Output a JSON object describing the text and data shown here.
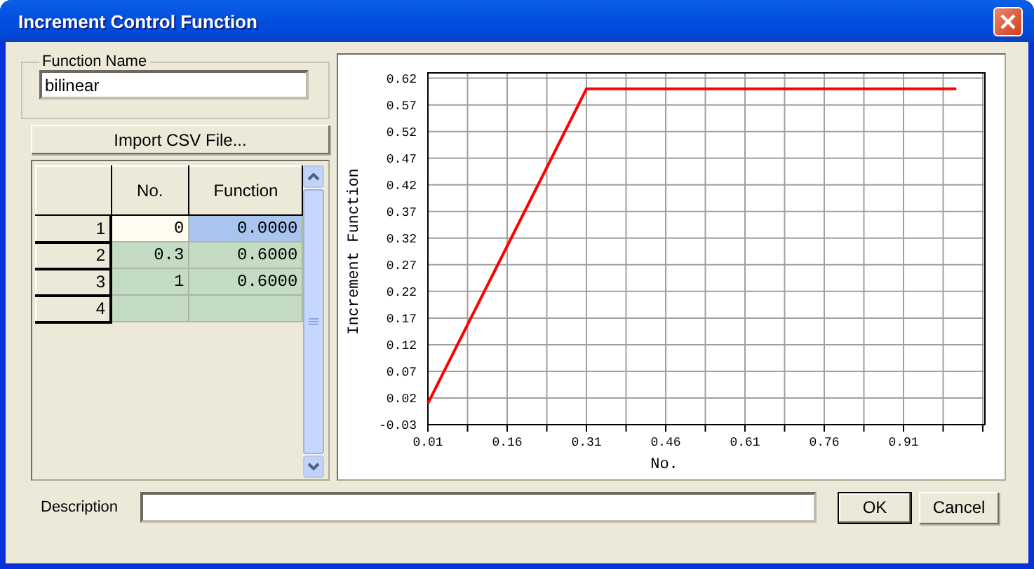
{
  "window": {
    "title": "Increment Control Function"
  },
  "function_name": {
    "label": "Function Name",
    "value": "bilinear"
  },
  "import_button": "Import CSV File...",
  "table": {
    "columns": [
      "No.",
      "Function"
    ],
    "rows": [
      {
        "header": "1",
        "no": "0",
        "function": "0.0000",
        "selected": true
      },
      {
        "header": "2",
        "no": "0.3",
        "function": "0.6000",
        "selected": false
      },
      {
        "header": "3",
        "no": "1",
        "function": "0.6000",
        "selected": false
      },
      {
        "header": "4",
        "selected": false
      }
    ]
  },
  "chart": {
    "chart_data": {
      "type": "line",
      "xlabel": "No.",
      "ylabel": "Increment Function",
      "xlim": [
        0.01,
        1.064
      ],
      "ylim": [
        -0.03,
        0.63
      ],
      "xticks": [
        0.01,
        0.16,
        0.31,
        0.46,
        0.61,
        0.76,
        0.91
      ],
      "yticks": [
        -0.03,
        0.02,
        0.07,
        0.12,
        0.17,
        0.22,
        0.27,
        0.32,
        0.37,
        0.42,
        0.47,
        0.52,
        0.57,
        0.62
      ],
      "x": [
        0.01,
        0.31,
        1.01
      ],
      "grid": true,
      "series": [
        {
          "color": "#ff0000",
          "values": [
            0.01,
            0.6,
            0.6
          ]
        }
      ]
    }
  },
  "description": {
    "label": "Description"
  },
  "buttons": [
    "OK",
    "Cancel"
  ]
}
